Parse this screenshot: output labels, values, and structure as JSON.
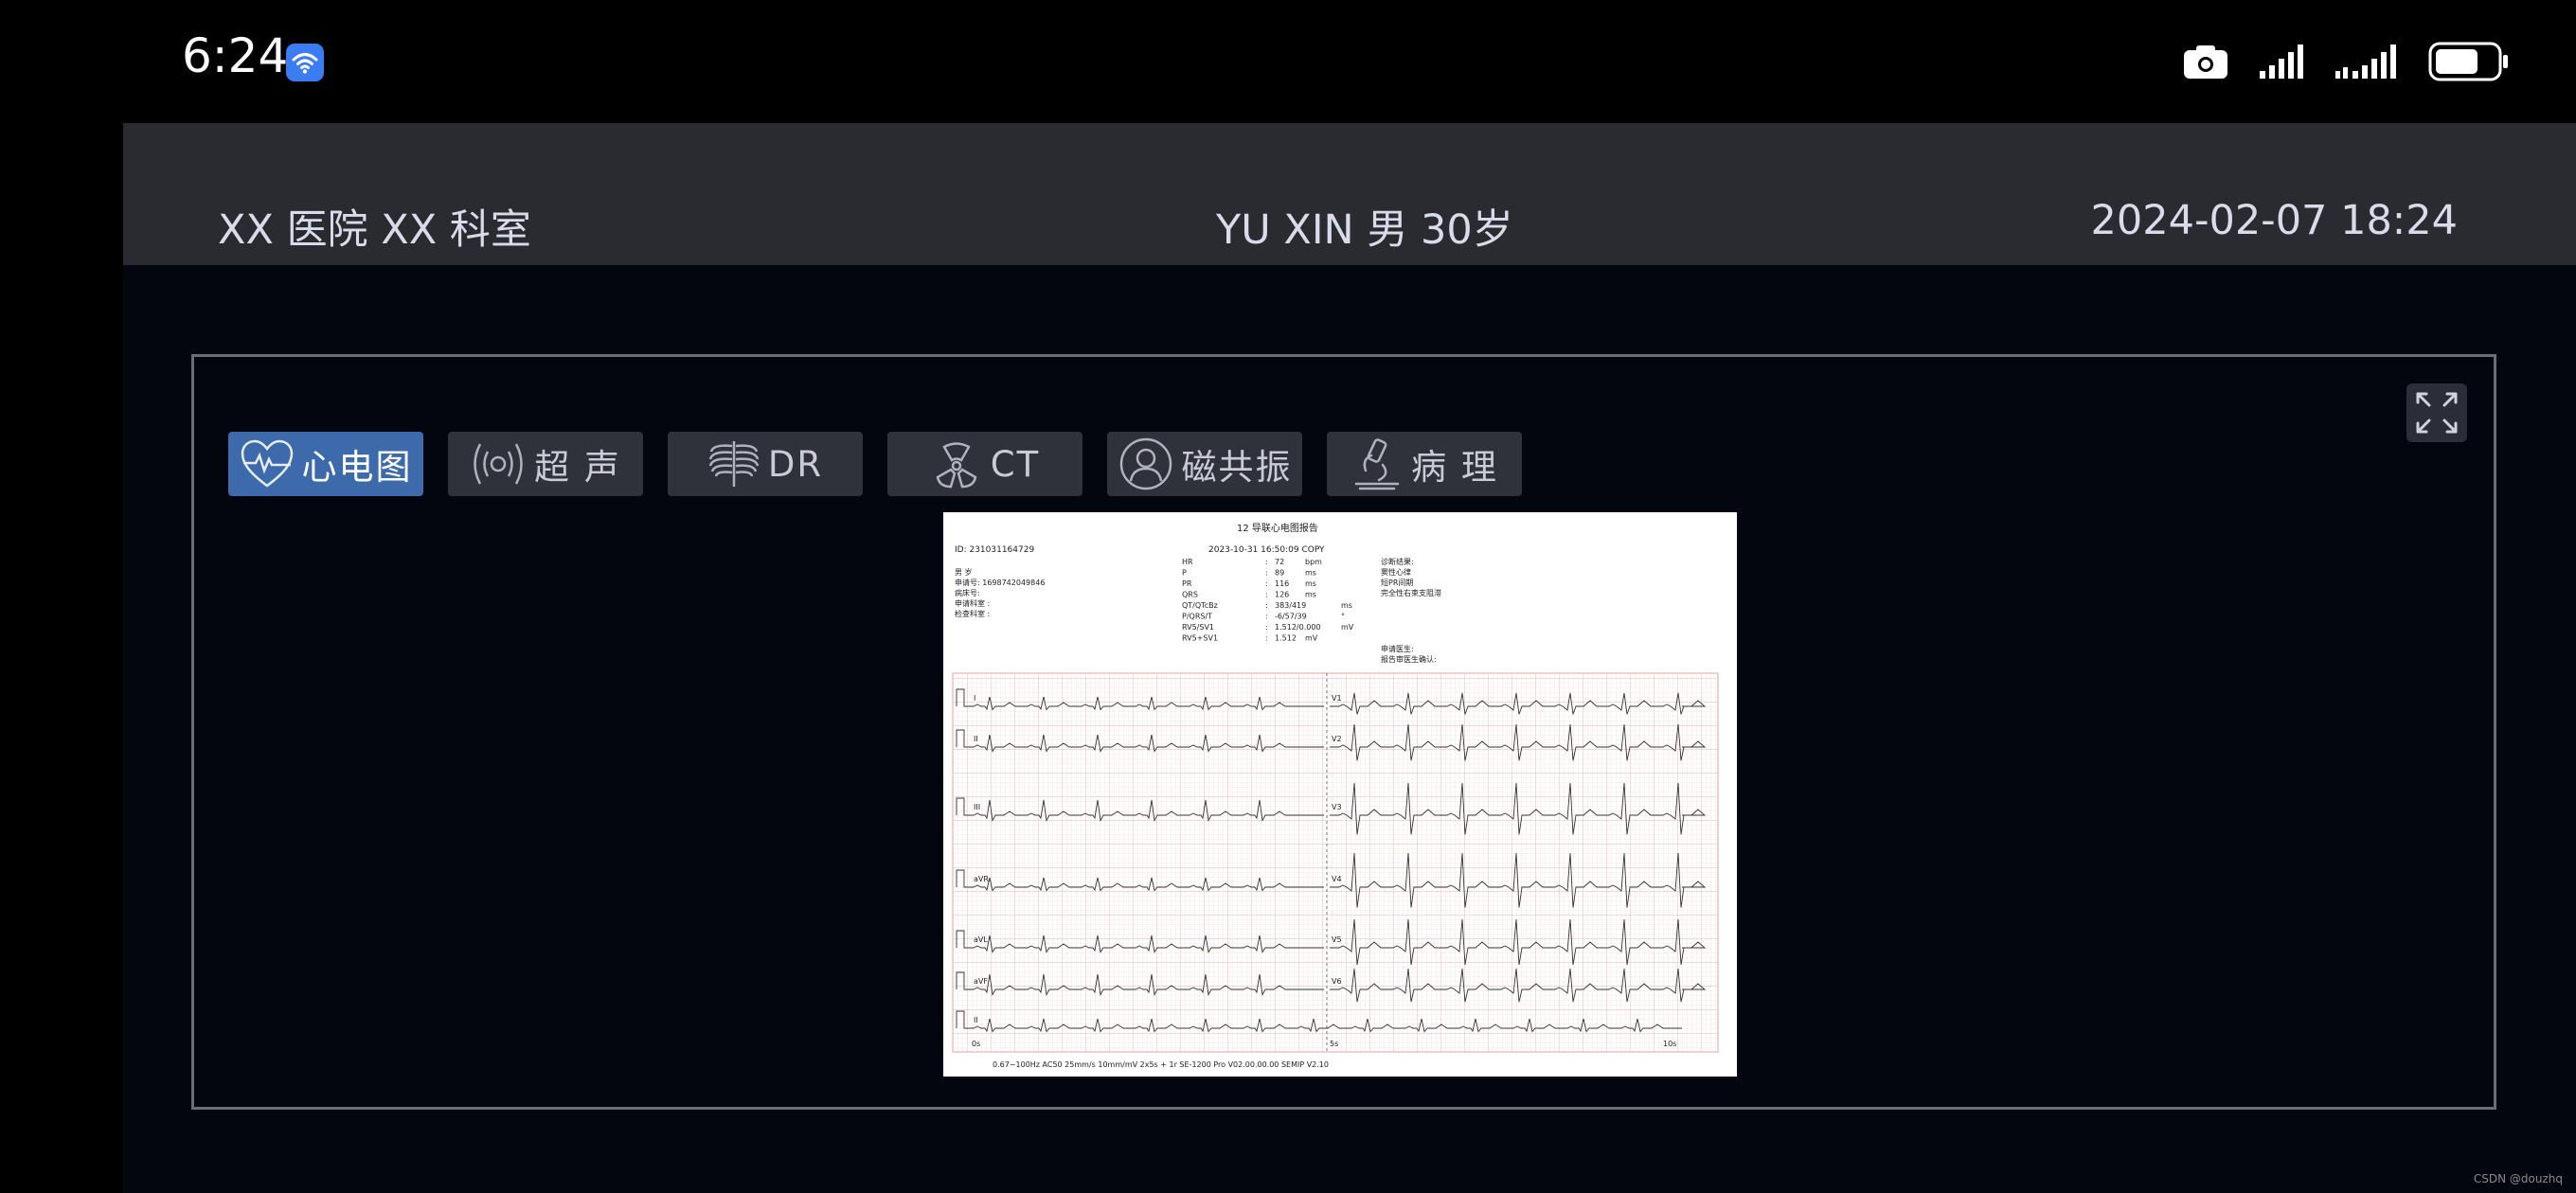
{
  "status_bar": {
    "time": "6:24",
    "icons": [
      "wifi-icon",
      "camera-icon",
      "signal-icon",
      "signal-icon",
      "battery-icon"
    ]
  },
  "header": {
    "hospital": "XX 医院 XX 科室",
    "patient": "YU XIN 男 30岁",
    "datetime": "2024-02-07 18:24"
  },
  "tabs": [
    {
      "label": "心电图",
      "icon": "heart-pulse-icon",
      "active": true
    },
    {
      "label": "超 声",
      "icon": "ultrasound-icon",
      "active": false
    },
    {
      "label": "DR",
      "icon": "ribcage-icon",
      "active": false
    },
    {
      "label": "CT",
      "icon": "radiation-icon",
      "active": false
    },
    {
      "label": "磁共振",
      "icon": "head-scan-icon",
      "active": false
    },
    {
      "label": "病 理",
      "icon": "microscope-icon",
      "active": false
    }
  ],
  "ecg_report": {
    "title": "12 导联心电图报告",
    "id": "ID:  231031164729",
    "date_line": "2023-10-31  16:50:09   COPY",
    "gender_age": "男      岁",
    "apply_no": "申请号:  1698742049846",
    "bed_no": "病床号:",
    "apply_dept": "申请科室 :",
    "exam_dept": "检查科室 :",
    "measurements": [
      {
        "name": "HR",
        "value": "72",
        "unit": "bpm"
      },
      {
        "name": "P",
        "value": "89",
        "unit": "ms"
      },
      {
        "name": "PR",
        "value": "116",
        "unit": "ms"
      },
      {
        "name": "QRS",
        "value": "126",
        "unit": "ms"
      },
      {
        "name": "QT/QTcBz",
        "value": "383/419",
        "unit": "ms"
      },
      {
        "name": "P/QRS/T",
        "value": "-6/57/39",
        "unit": "°"
      },
      {
        "name": "RV5/SV1",
        "value": "1.512/0.000",
        "unit": "mV"
      },
      {
        "name": "RV5+SV1",
        "value": "1.512",
        "unit": "mV"
      }
    ],
    "diagnosis_title": "诊断结果:",
    "diagnosis": [
      "窦性心律",
      "短PR间期",
      "完全性右束支阻滞"
    ],
    "doctor": "申请医生:",
    "confirm": "报告审医生确认:",
    "leads_left": [
      "I",
      "II",
      "III",
      "aVR",
      "aVL",
      "aVF",
      "II"
    ],
    "leads_right": [
      "V1",
      "V2",
      "V3",
      "V4",
      "V5",
      "V6"
    ],
    "time_marks": [
      "0s",
      "5s",
      "10s"
    ],
    "footer": "0.67~100Hz  AC50   25mm/s  10mm/mV  2x5s + 1r   SE-1200 Pro  V02.00.00.00   SEMIP  V2.10"
  },
  "watermark": "CSDN @douzhq",
  "colors": {
    "accent_tab": "#3c6aaa",
    "header_bg": "#2a2b30",
    "app_bg": "#04060f"
  }
}
